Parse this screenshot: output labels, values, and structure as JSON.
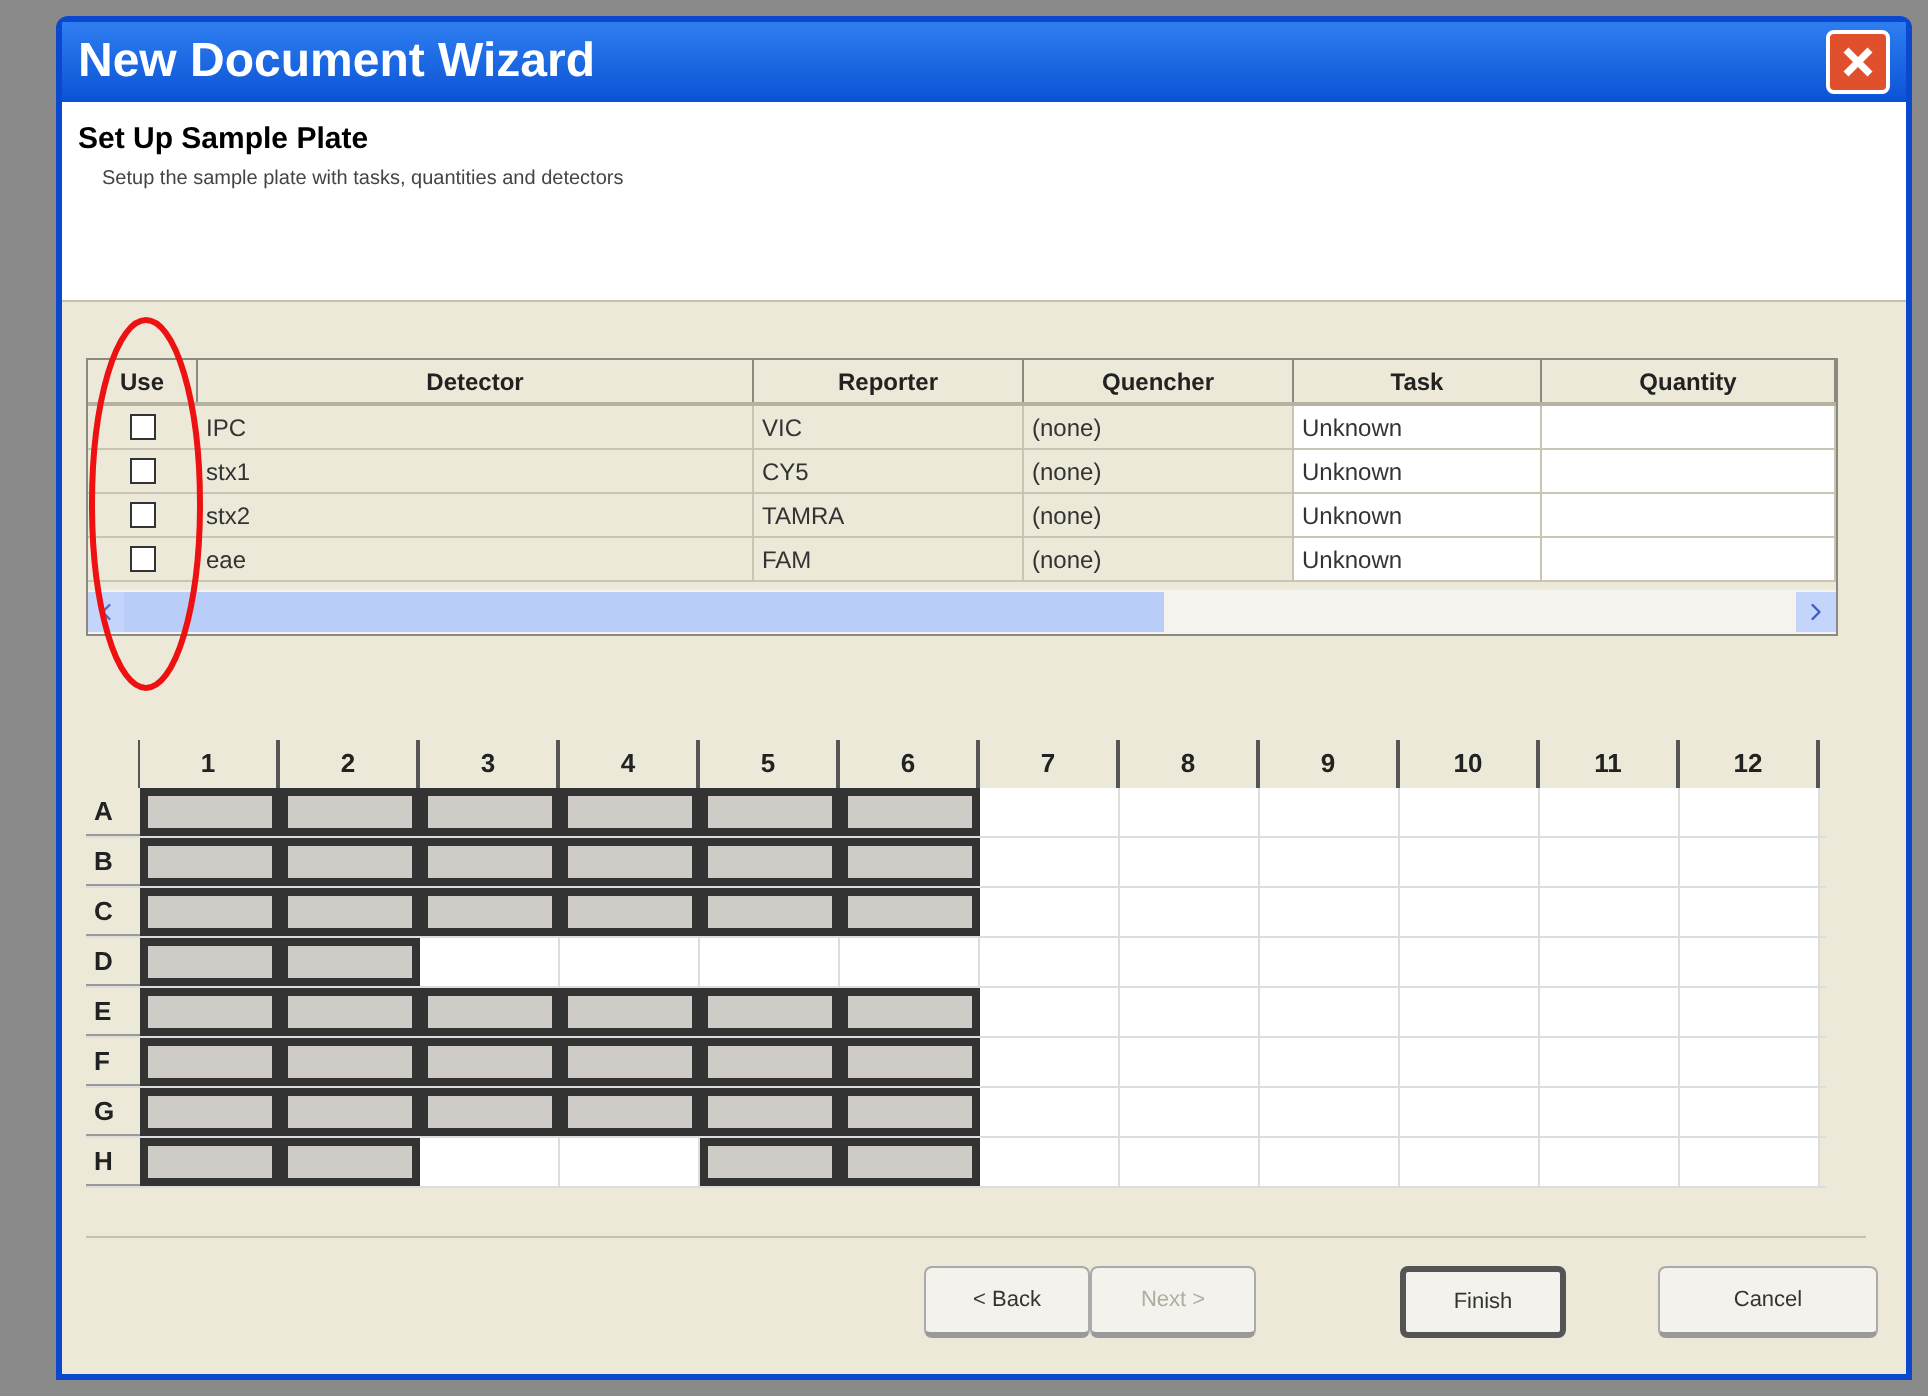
{
  "window": {
    "title": "New Document Wizard"
  },
  "header": {
    "title": "Set Up Sample Plate",
    "subtitle": "Setup the sample plate with tasks, quantities and detectors"
  },
  "detectors": {
    "columns": [
      "Use",
      "Detector",
      "Reporter",
      "Quencher",
      "Task",
      "Quantity"
    ],
    "rows": [
      {
        "checked": false,
        "detector": "IPC",
        "reporter": "VIC",
        "quencher": "(none)",
        "task": "Unknown",
        "quantity": ""
      },
      {
        "checked": false,
        "detector": "stx1",
        "reporter": "CY5",
        "quencher": "(none)",
        "task": "Unknown",
        "quantity": ""
      },
      {
        "checked": false,
        "detector": "stx2",
        "reporter": "TAMRA",
        "quencher": "(none)",
        "task": "Unknown",
        "quantity": ""
      },
      {
        "checked": false,
        "detector": "eae",
        "reporter": "FAM",
        "quencher": "(none)",
        "task": "Unknown",
        "quantity": ""
      }
    ]
  },
  "plate": {
    "columns": [
      "1",
      "2",
      "3",
      "4",
      "5",
      "6",
      "7",
      "8",
      "9",
      "10",
      "11",
      "12"
    ],
    "rows": [
      {
        "label": "A",
        "used": [
          true,
          true,
          true,
          true,
          true,
          true,
          false,
          false,
          false,
          false,
          false,
          false
        ]
      },
      {
        "label": "B",
        "used": [
          true,
          true,
          true,
          true,
          true,
          true,
          false,
          false,
          false,
          false,
          false,
          false
        ]
      },
      {
        "label": "C",
        "used": [
          true,
          true,
          true,
          true,
          true,
          true,
          false,
          false,
          false,
          false,
          false,
          false
        ]
      },
      {
        "label": "D",
        "used": [
          true,
          true,
          false,
          false,
          false,
          false,
          false,
          false,
          false,
          false,
          false,
          false
        ]
      },
      {
        "label": "E",
        "used": [
          true,
          true,
          true,
          true,
          true,
          true,
          false,
          false,
          false,
          false,
          false,
          false
        ]
      },
      {
        "label": "F",
        "used": [
          true,
          true,
          true,
          true,
          true,
          true,
          false,
          false,
          false,
          false,
          false,
          false
        ]
      },
      {
        "label": "G",
        "used": [
          true,
          true,
          true,
          true,
          true,
          true,
          false,
          false,
          false,
          false,
          false,
          false
        ]
      },
      {
        "label": "H",
        "used": [
          true,
          true,
          false,
          false,
          true,
          true,
          false,
          false,
          false,
          false,
          false,
          false
        ]
      }
    ]
  },
  "buttons": [
    {
      "label": "< Back",
      "disabled": false,
      "default": false
    },
    {
      "label": "Next >",
      "disabled": true,
      "default": false
    },
    {
      "label": "Finish",
      "disabled": false,
      "default": true
    },
    {
      "label": "Cancel",
      "disabled": false,
      "default": false
    }
  ]
}
